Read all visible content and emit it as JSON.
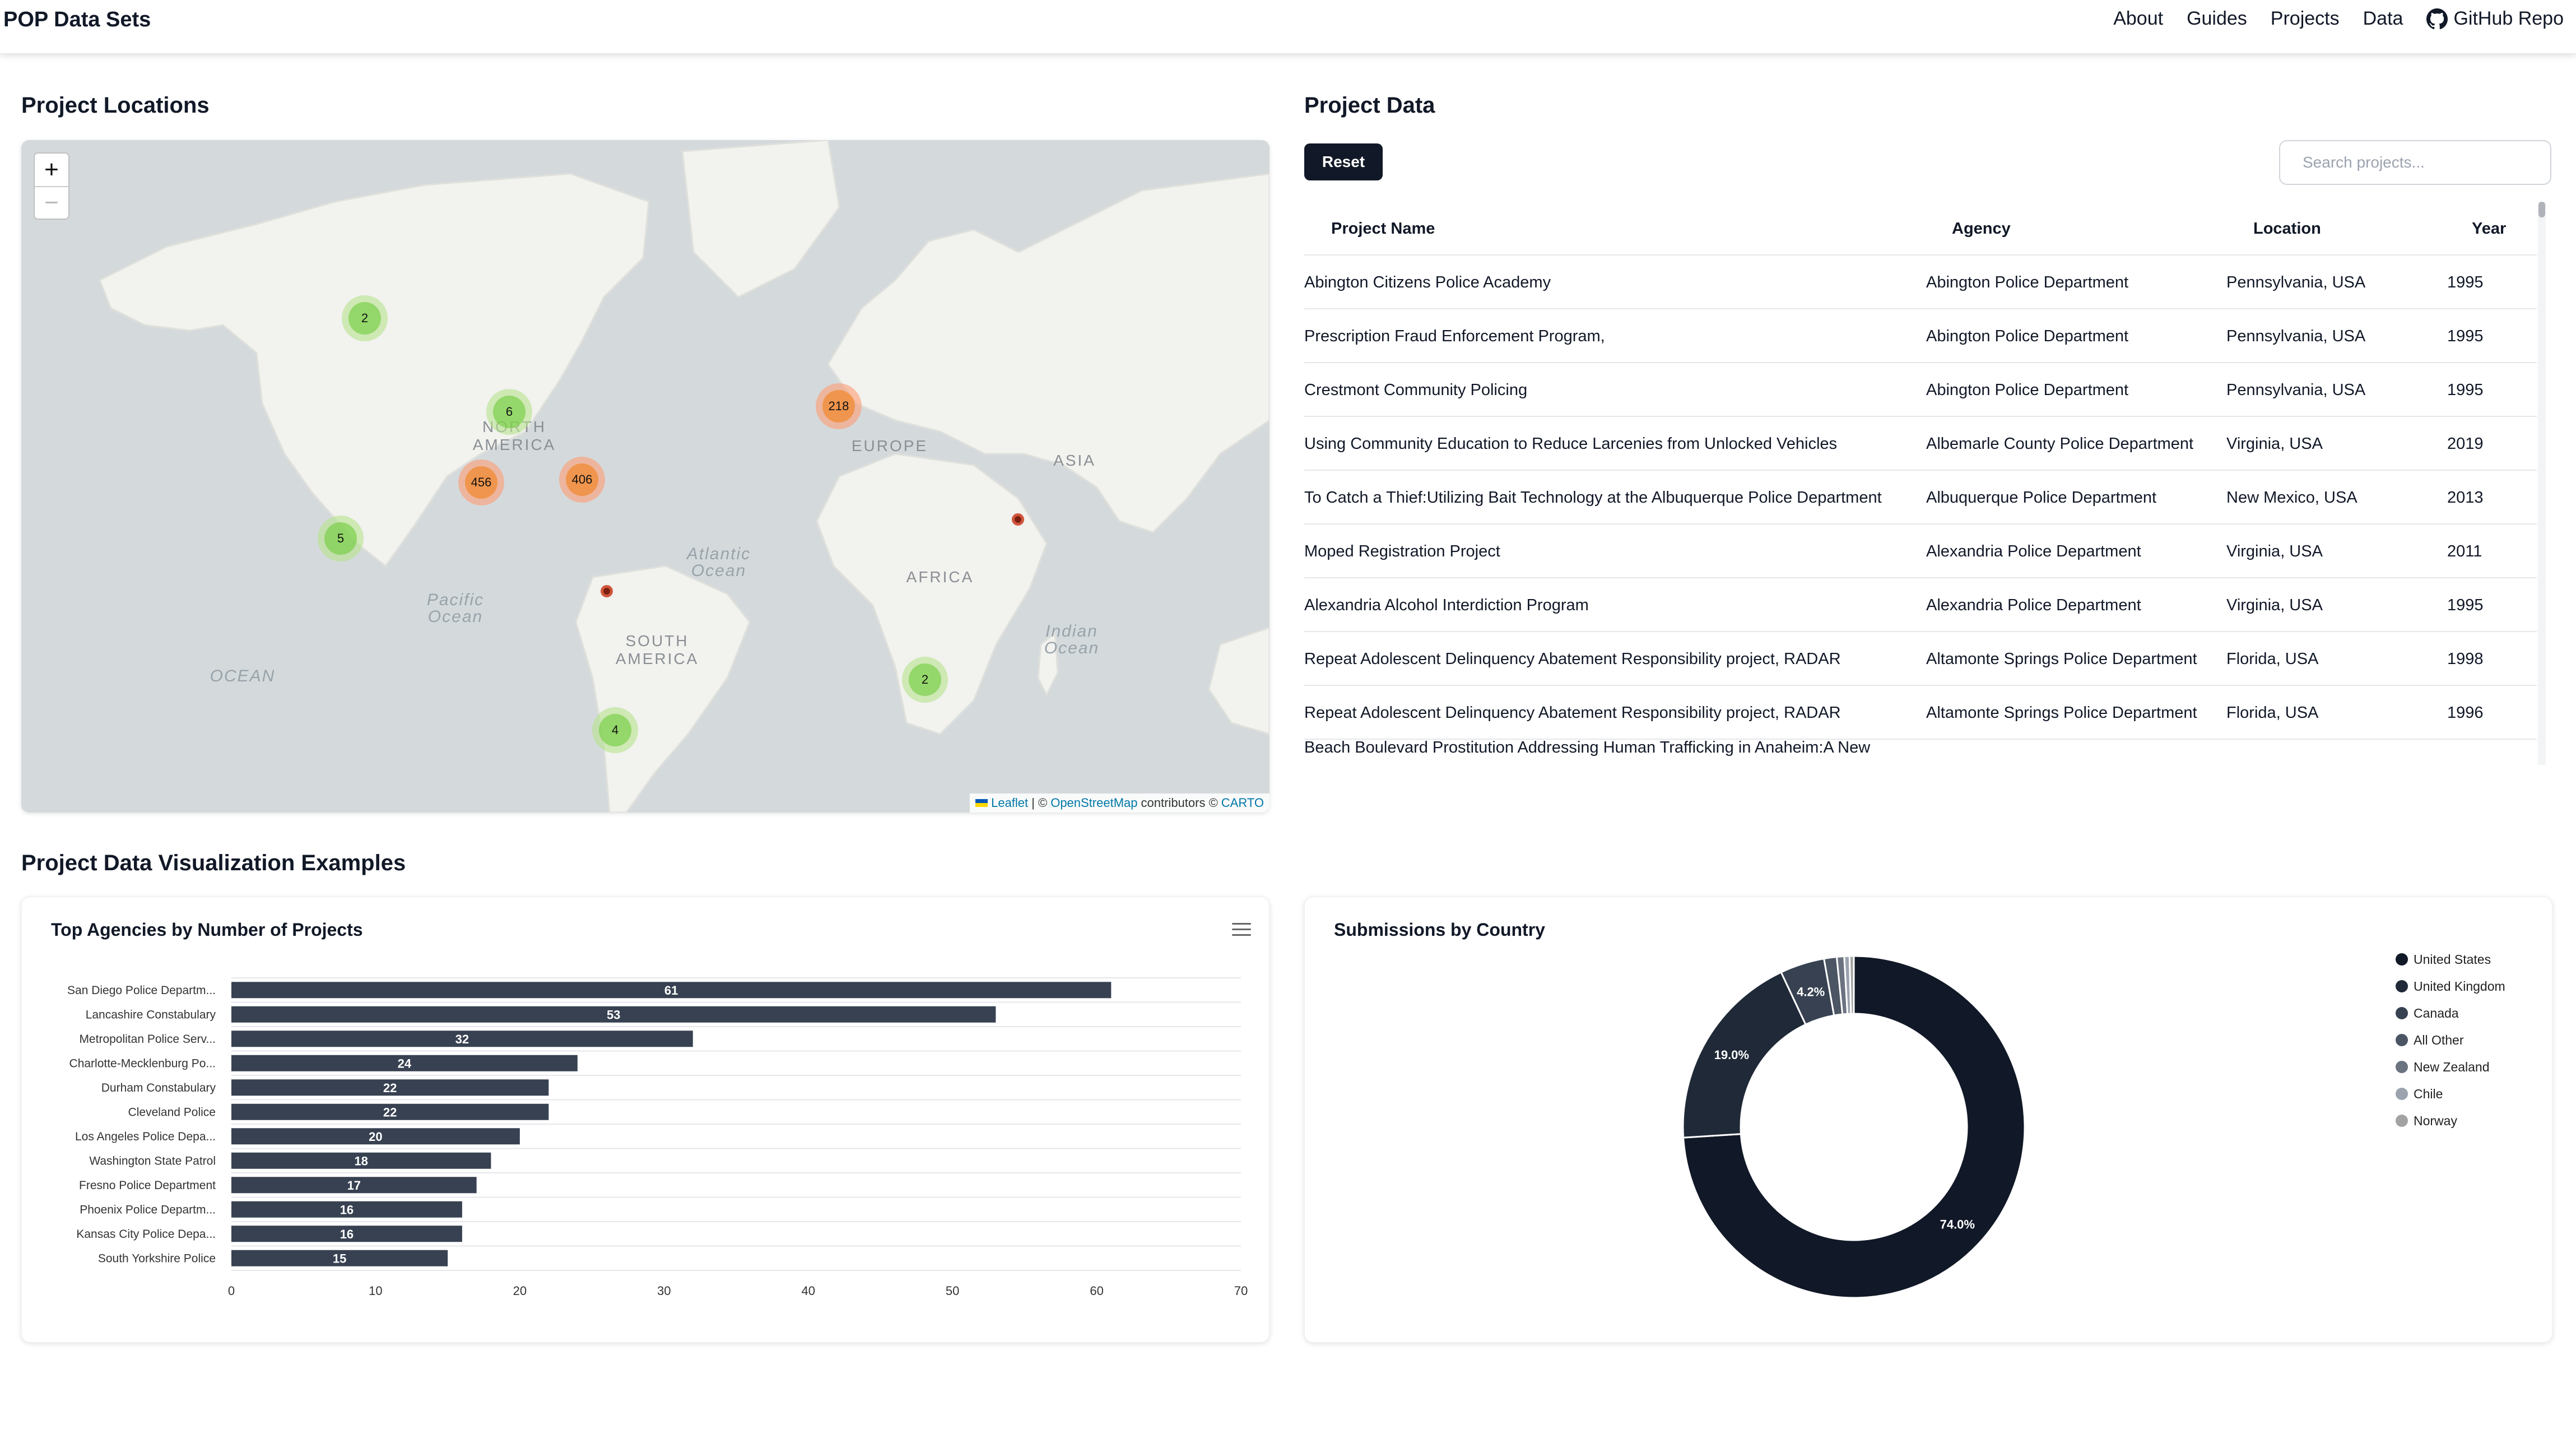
{
  "nav": {
    "brand": "POP Data Sets",
    "links": [
      "About",
      "Guides",
      "Projects",
      "Data"
    ],
    "github_label": "GitHub Repo"
  },
  "map_section": {
    "title": "Project Locations",
    "zoom_in": "+",
    "zoom_out": "−",
    "continent_labels": [
      "NORTH AMERICA",
      "EUROPE",
      "ASIA",
      "AFRICA",
      "SOUTH AMERICA"
    ],
    "ocean_labels": [
      "Atlantic Ocean",
      "Pacific Ocean",
      "Indian Ocean",
      "OCEAN"
    ],
    "clusters": [
      {
        "count": "2",
        "color": "green"
      },
      {
        "count": "6",
        "color": "green"
      },
      {
        "count": "218",
        "color": "orange"
      },
      {
        "count": "456",
        "color": "orange"
      },
      {
        "count": "406",
        "color": "orange"
      },
      {
        "count": "5",
        "color": "green"
      },
      {
        "count": "2",
        "color": "green"
      },
      {
        "count": "4",
        "color": "green"
      }
    ],
    "attribution": {
      "leaflet": "Leaflet",
      "sep": "| ©",
      "osm": "OpenStreetMap",
      "contributors": "contributors ©",
      "carto": "CARTO"
    }
  },
  "table_section": {
    "title": "Project Data",
    "reset_label": "Reset",
    "search_placeholder": "Search projects...",
    "columns": [
      "Project Name",
      "Agency",
      "Location",
      "Year"
    ],
    "rows": [
      [
        "Abington Citizens Police Academy",
        "Abington Police Department",
        "Pennsylvania, USA",
        "1995"
      ],
      [
        "Prescription Fraud Enforcement Program,",
        "Abington Police Department",
        "Pennsylvania, USA",
        "1995"
      ],
      [
        "Crestmont Community Policing",
        "Abington Police Department",
        "Pennsylvania, USA",
        "1995"
      ],
      [
        "Using Community Education to Reduce Larcenies from Unlocked Vehicles",
        "Albemarle County Police Department",
        "Virginia, USA",
        "2019"
      ],
      [
        "To Catch a Thief:Utilizing Bait Technology at the Albuquerque Police Department",
        "Albuquerque Police Department",
        "New Mexico, USA",
        "2013"
      ],
      [
        "Moped Registration Project",
        "Alexandria Police Department",
        "Virginia, USA",
        "2011"
      ],
      [
        "Alexandria Alcohol Interdiction Program",
        "Alexandria Police Department",
        "Virginia, USA",
        "1995"
      ],
      [
        "Repeat Adolescent Delinquency Abatement Responsibility project, RADAR",
        "Altamonte Springs Police Department",
        "Florida, USA",
        "1998"
      ],
      [
        "Repeat Adolescent Delinquency Abatement Responsibility project, RADAR",
        "Altamonte Springs Police Department",
        "Florida, USA",
        "1996"
      ],
      [
        "Beach Boulevard Prostitution Addressing Human Trafficking in Anaheim:A New",
        "",
        "",
        ""
      ]
    ]
  },
  "viz_section": {
    "title": "Project Data Visualization Examples"
  },
  "chart_data": [
    {
      "type": "bar",
      "title": "Top Agencies by Number of Projects",
      "orientation": "horizontal",
      "categories": [
        "San Diego Police Departm...",
        "Lancashire Constabulary",
        "Metropolitan Police Serv...",
        "Charlotte-Mecklenburg Po...",
        "Durham Constabulary",
        "Cleveland Police",
        "Los Angeles Police Depa...",
        "Washington State Patrol",
        "Fresno Police Department",
        "Phoenix Police Departm...",
        "Kansas City Police Depa...",
        "South Yorkshire Police"
      ],
      "values": [
        61,
        53,
        32,
        24,
        22,
        22,
        20,
        18,
        17,
        16,
        16,
        15
      ],
      "xlim": [
        0,
        70
      ],
      "xticks": [
        0,
        10,
        20,
        30,
        40,
        50,
        60,
        70
      ],
      "bar_color": "#374151",
      "grid": true
    },
    {
      "type": "pie",
      "style": "donut",
      "title": "Submissions by Country",
      "categories": [
        "United States",
        "United Kingdom",
        "Canada",
        "All Other",
        "New Zealand",
        "Chile",
        "Norway"
      ],
      "values": [
        74.0,
        19.0,
        4.2,
        1.2,
        0.7,
        0.5,
        0.4
      ],
      "data_labels": [
        "74.0%",
        "19.0%",
        "4.2%",
        "",
        "",
        "",
        ""
      ],
      "colors": [
        "#111827",
        "#1f2937",
        "#374151",
        "#4b5563",
        "#6b7280",
        "#9ca3af",
        "#a3a3a3"
      ],
      "legend_position": "top-right"
    }
  ]
}
